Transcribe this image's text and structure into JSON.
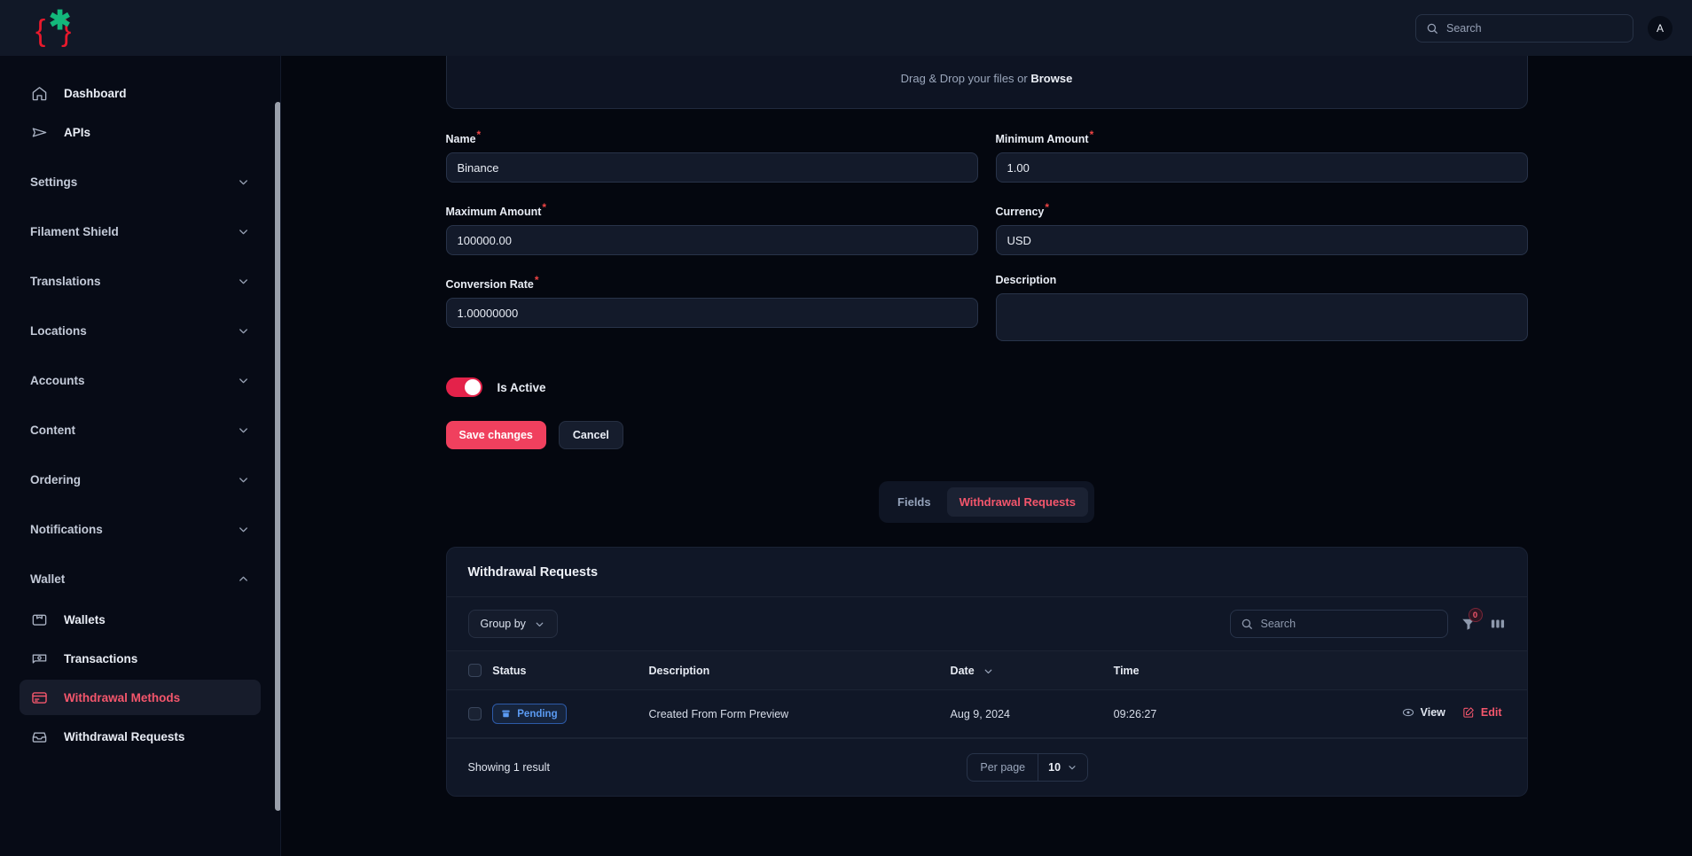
{
  "brand": {
    "accent": "#f0405e",
    "logo_icon": "code-braces-star-logo"
  },
  "topbar": {
    "search": {
      "placeholder": "Search",
      "value": ""
    },
    "avatar_initial": "A"
  },
  "sidebar": {
    "links": [
      {
        "label": "Dashboard",
        "icon": "home-icon"
      },
      {
        "label": "APIs",
        "icon": "paper-plane-icon"
      }
    ],
    "groups": [
      {
        "label": "Settings",
        "expanded": false
      },
      {
        "label": "Filament Shield",
        "expanded": false
      },
      {
        "label": "Translations",
        "expanded": false
      },
      {
        "label": "Locations",
        "expanded": false
      },
      {
        "label": "Accounts",
        "expanded": false
      },
      {
        "label": "Content",
        "expanded": false
      },
      {
        "label": "Ordering",
        "expanded": false
      },
      {
        "label": "Notifications",
        "expanded": false
      }
    ],
    "wallet_group": {
      "label": "Wallet",
      "expanded": true
    },
    "wallet_items": [
      {
        "label": "Wallets",
        "icon": "wallet-icon",
        "active": false
      },
      {
        "label": "Transactions",
        "icon": "banknote-icon",
        "active": false
      },
      {
        "label": "Withdrawal Methods",
        "icon": "credit-card-icon",
        "active": true
      },
      {
        "label": "Withdrawal Requests",
        "icon": "inbox-icon",
        "active": false
      }
    ]
  },
  "form": {
    "dropzone": {
      "text_prefix": "Drag & Drop your files or ",
      "browse": "Browse"
    },
    "fields": {
      "name": {
        "label": "Name",
        "required": "*",
        "value": "Binance"
      },
      "minimum_amount": {
        "label": "Minimum Amount",
        "required": "*",
        "value": "1.00"
      },
      "maximum_amount": {
        "label": "Maximum Amount",
        "required": "*",
        "value": "100000.00"
      },
      "currency": {
        "label": "Currency",
        "required": "*",
        "value": "USD"
      },
      "conversion_rate": {
        "label": "Conversion Rate",
        "required": "*",
        "value": "1.00000000"
      },
      "description": {
        "label": "Description",
        "required": "",
        "value": ""
      }
    },
    "toggle": {
      "label": "Is Active",
      "on": true
    },
    "buttons": {
      "save": "Save changes",
      "cancel": "Cancel"
    }
  },
  "tabs": [
    {
      "label": "Fields",
      "active": false
    },
    {
      "label": "Withdrawal Requests",
      "active": true
    }
  ],
  "table": {
    "title": "Withdrawal Requests",
    "group_by_label": "Group by",
    "search": {
      "placeholder": "Search",
      "value": ""
    },
    "filter_badge": "0",
    "columns": [
      "Status",
      "Description",
      "Date",
      "Time",
      ""
    ],
    "rows": [
      {
        "status": "Pending",
        "status_icon": "archive-box-icon",
        "description": "Created From Form Preview",
        "date": "Aug 9, 2024",
        "time": "09:26:27",
        "view_label": "View",
        "edit_label": "Edit"
      }
    ],
    "footer": {
      "showing": "Showing 1 result",
      "per_page_label": "Per page",
      "per_page_value": "10"
    }
  }
}
